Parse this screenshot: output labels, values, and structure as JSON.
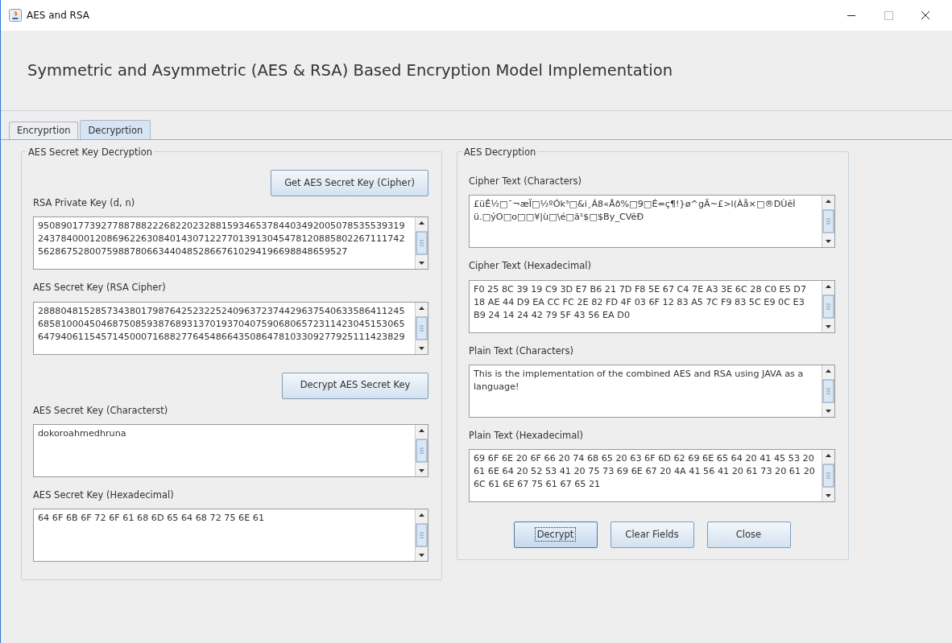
{
  "window": {
    "title": "AES and RSA"
  },
  "heading": "Symmetric and Asymmetric (AES & RSA) Based Encryption Model Implementation",
  "tabs": [
    {
      "label": "Encryprtion",
      "selected": false
    },
    {
      "label": "Decryprtion",
      "selected": true
    }
  ],
  "left_panel": {
    "title": "AES Secret Key Decryption",
    "items": [
      {
        "kind": "button",
        "label": "Get AES Secret Key (Cipher)",
        "focused": false
      },
      {
        "kind": "field",
        "label": "RSA Private Key (d, n)",
        "lines": [
          "9508901773927788788222682202328815934653784403492005078535539319",
          "2437840001208696226308401430712277013913045478120885802267111742",
          "562867528007598878066344048528667610294196698848659527"
        ]
      },
      {
        "kind": "field",
        "label": "AES Secret Key (RSA Cipher)",
        "lines": [
          "2888048152857343801798764252322524096372374429637540633586411245",
          "6858100045046875085938768931370193704075906806572311423045153065",
          "6479406115457145000716882776454866435086478103309277925111423829"
        ]
      },
      {
        "kind": "button",
        "label": "Decrypt AES Secret Key",
        "focused": false
      },
      {
        "kind": "field",
        "label": "AES Secret Key (Characterst)",
        "lines": [
          "dokoroahmedhruna"
        ]
      },
      {
        "kind": "field",
        "label": "AES Secret Key (Hexadecimal)",
        "lines": [
          "64 6F 6B 6F 72 6F 61 68 6D 65 64 68 72 75 6E 61"
        ]
      }
    ]
  },
  "right_panel": {
    "title": "AES Decryption",
    "items": [
      {
        "kind": "field",
        "label": "Cipher Text (Characters)",
        "lines": [
          "£üÊ½□¯¬æÏ□½ºÓk³□&i¸Á8«Åð%□9□É=ç¶!}ø^gÄ~£>l(Àå×□®DÙêÌ",
          "ü.□ýO□o□□¥|ù□\\é□ã¹$□$By_CVêÐ"
        ]
      },
      {
        "kind": "field",
        "label": "Cipher Text (Hexadecimal)",
        "lines": [
          "F0 25 8C 39 19 C9 3D E7 B6 21 7D F8 5E 67 C4 7E A3 3E 6C 28 C0 E5 D7",
          "18 AE 44 D9 EA CC FC 2E 82 FD 4F 03 6F 12 83 A5 7C F9 83 5C E9 0C E3",
          "B9 24 14 24 42 79 5F 43 56 EA D0"
        ]
      },
      {
        "kind": "field",
        "label": "Plain Text (Characters)",
        "lines": [
          "This is the implementation of the combined AES and RSA using JAVA as a",
          "language!"
        ]
      },
      {
        "kind": "field",
        "label": "Plain Text (Hexadecimal)",
        "lines": [
          "69 6F 6E 20 6F 66 20 74 68 65 20 63 6F 6D 62 69 6E 65 64 20 41 45 53 20",
          "61 6E 64 20 52 53 41 20 75 73 69 6E 67 20 4A 41 56 41 20 61 73 20 61 20",
          "6C 61 6E 67 75 61 67 65 21"
        ]
      }
    ],
    "buttons": [
      {
        "label": "Decrypt",
        "focused": true
      },
      {
        "label": "Clear Fields",
        "focused": false
      },
      {
        "label": "Close",
        "focused": false
      }
    ]
  }
}
